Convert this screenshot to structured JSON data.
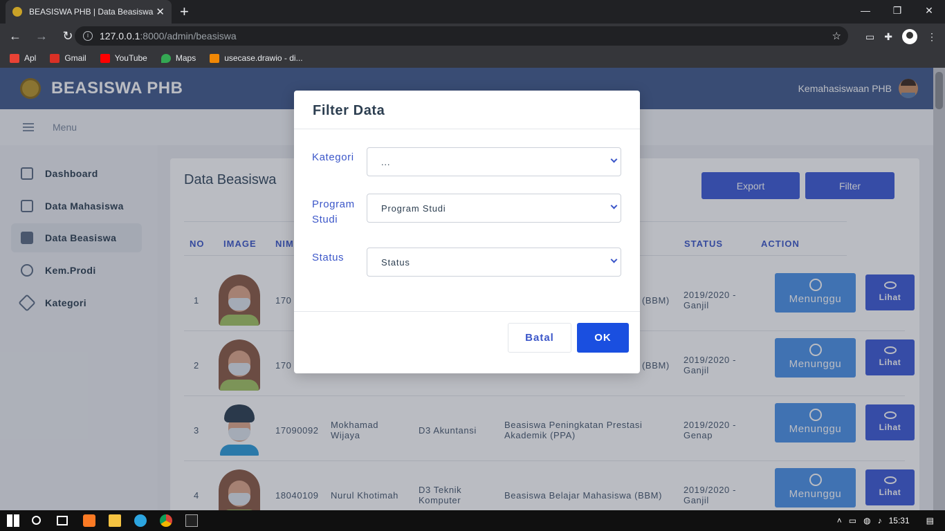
{
  "browser": {
    "tab_title": "BEASISWA PHB | Data Beasiswa",
    "tab_close": "✕",
    "new_tab": "+",
    "url_host": "127.0.0.1",
    "url_path": ":8000/admin/beasiswa",
    "bookmarks": [
      {
        "label": "Apl",
        "color": "#e94235"
      },
      {
        "label": "Gmail",
        "color": "#d93025"
      },
      {
        "label": "YouTube",
        "color": "#ff0000"
      },
      {
        "label": "Maps",
        "color": "#34a853"
      },
      {
        "label": "usecase.drawio - di...",
        "color": "#f08705"
      }
    ]
  },
  "app": {
    "brand": "BEASISWA PHB",
    "user": "Kemahasiswaan PHB",
    "menu_label": "Menu",
    "sidebar": [
      {
        "label": "Dashboard",
        "icon": "home-icon"
      },
      {
        "label": "Data Mahasiswa",
        "icon": "document-icon"
      },
      {
        "label": "Data Beasiswa",
        "icon": "folder-icon",
        "active": true
      },
      {
        "label": "Kem.Prodi",
        "icon": "user-icon"
      },
      {
        "label": "Kategori",
        "icon": "tag-icon"
      }
    ],
    "page_title": "Data Beasiswa",
    "export_label": "Export",
    "filter_label": "Filter",
    "table": {
      "headers": [
        "NO",
        "IMAGE",
        "NIM",
        "STATUS",
        "ACTION"
      ],
      "rows": [
        {
          "no": "1",
          "nim": "170",
          "nama": "",
          "prodi": "",
          "beasiswa": "(BBM)",
          "periode": "2019/2020 - Ganjil",
          "status": "Menunggu",
          "action": "Lihat"
        },
        {
          "no": "2",
          "nim": "170",
          "nama": "",
          "prodi": "",
          "beasiswa": "(BBM)",
          "periode": "2019/2020 - Ganjil",
          "status": "Menunggu",
          "action": "Lihat"
        },
        {
          "no": "3",
          "nim": "17090092",
          "nama": "Mokhamad Wijaya",
          "prodi": "D3 Akuntansi",
          "beasiswa": "Beasiswa Peningkatan Prestasi Akademik (PPA)",
          "periode": "2019/2020 - Genap",
          "status": "Menunggu",
          "action": "Lihat"
        },
        {
          "no": "4",
          "nim": "18040109",
          "nama": "Nurul Khotimah",
          "prodi": "D3 Teknik Komputer",
          "beasiswa": "Beasiswa Belajar Mahasiswa (BBM)",
          "periode": "2019/2020 - Ganjil",
          "status": "Menunggu",
          "action": "Lihat"
        }
      ]
    }
  },
  "modal": {
    "title": "Filter Data",
    "kategori_label": "Kategori",
    "kategori_value": "...",
    "prodi_label_1": "Program",
    "prodi_label_2": "Studi",
    "prodi_value": "Program Studi",
    "status_label": "Status",
    "status_value": "Status",
    "cancel": "Batal",
    "ok": "OK"
  },
  "taskbar": {
    "time": "15:31"
  }
}
